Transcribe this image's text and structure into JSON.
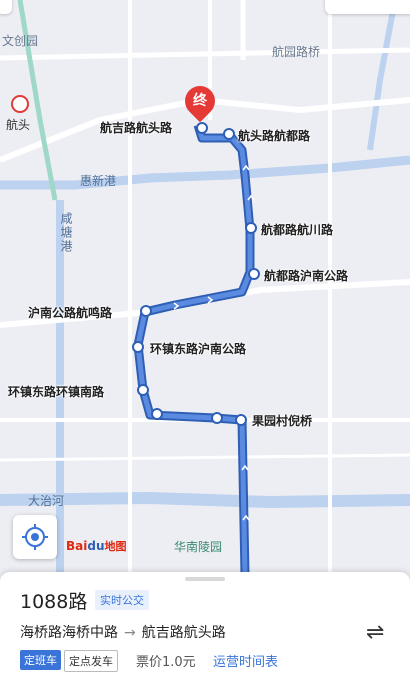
{
  "map": {
    "top_left_partial": "",
    "top_right_partial": "",
    "places": {
      "wenchi_park": "文创园",
      "hangyuan_bridge": "航园路桥",
      "hangtou": "航头",
      "huaxin_port": "惠新港",
      "xiantang_port": "咸塘港",
      "dazhi_river": "大治河",
      "huanan_cemetery": "华南陵园"
    },
    "terminal_label": "终",
    "stops": [
      "航吉路航头路",
      "航头路航都路",
      "航都路航川路",
      "航都路沪南公路",
      "沪南公路航鸣路",
      "环镇东路沪南公路",
      "环镇东路环镇南路",
      "果园村倪桥"
    ],
    "logo": "Bai地图"
  },
  "panel": {
    "route_name": "1088路",
    "realtime_badge": "实时公交",
    "from": "海桥路海桥中路",
    "arrow": "→",
    "to": "航吉路航头路",
    "tag_fixed": "定班车",
    "tag_depart": "定点发车",
    "fare": "票价1.0元",
    "hours_link": "运营时间表",
    "swap_icon": "⇌"
  },
  "colors": {
    "route_line": "#3a6fc9",
    "terminal": "#e53935",
    "accent": "#3a74d8"
  }
}
